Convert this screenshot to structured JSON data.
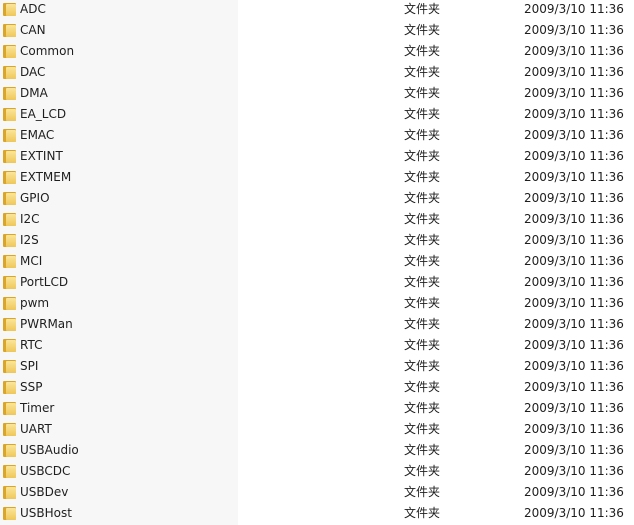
{
  "files": [
    {
      "name": "ADC",
      "type": "文件夹",
      "modified": "2009/3/10 11:36"
    },
    {
      "name": "CAN",
      "type": "文件夹",
      "modified": "2009/3/10 11:36"
    },
    {
      "name": "Common",
      "type": "文件夹",
      "modified": "2009/3/10 11:36"
    },
    {
      "name": "DAC",
      "type": "文件夹",
      "modified": "2009/3/10 11:36"
    },
    {
      "name": "DMA",
      "type": "文件夹",
      "modified": "2009/3/10 11:36"
    },
    {
      "name": "EA_LCD",
      "type": "文件夹",
      "modified": "2009/3/10 11:36"
    },
    {
      "name": "EMAC",
      "type": "文件夹",
      "modified": "2009/3/10 11:36"
    },
    {
      "name": "EXTINT",
      "type": "文件夹",
      "modified": "2009/3/10 11:36"
    },
    {
      "name": "EXTMEM",
      "type": "文件夹",
      "modified": "2009/3/10 11:36"
    },
    {
      "name": "GPIO",
      "type": "文件夹",
      "modified": "2009/3/10 11:36"
    },
    {
      "name": "I2C",
      "type": "文件夹",
      "modified": "2009/3/10 11:36"
    },
    {
      "name": "I2S",
      "type": "文件夹",
      "modified": "2009/3/10 11:36"
    },
    {
      "name": "MCI",
      "type": "文件夹",
      "modified": "2009/3/10 11:36"
    },
    {
      "name": "PortLCD",
      "type": "文件夹",
      "modified": "2009/3/10 11:36"
    },
    {
      "name": "pwm",
      "type": "文件夹",
      "modified": "2009/3/10 11:36"
    },
    {
      "name": "PWRMan",
      "type": "文件夹",
      "modified": "2009/3/10 11:36"
    },
    {
      "name": "RTC",
      "type": "文件夹",
      "modified": "2009/3/10 11:36"
    },
    {
      "name": "SPI",
      "type": "文件夹",
      "modified": "2009/3/10 11:36"
    },
    {
      "name": "SSP",
      "type": "文件夹",
      "modified": "2009/3/10 11:36"
    },
    {
      "name": "Timer",
      "type": "文件夹",
      "modified": "2009/3/10 11:36"
    },
    {
      "name": "UART",
      "type": "文件夹",
      "modified": "2009/3/10 11:36"
    },
    {
      "name": "USBAudio",
      "type": "文件夹",
      "modified": "2009/3/10 11:36"
    },
    {
      "name": "USBCDC",
      "type": "文件夹",
      "modified": "2009/3/10 11:36"
    },
    {
      "name": "USBDev",
      "type": "文件夹",
      "modified": "2009/3/10 11:36"
    },
    {
      "name": "USBHost",
      "type": "文件夹",
      "modified": "2009/3/10 11:36"
    }
  ],
  "icon": "folder-icon"
}
